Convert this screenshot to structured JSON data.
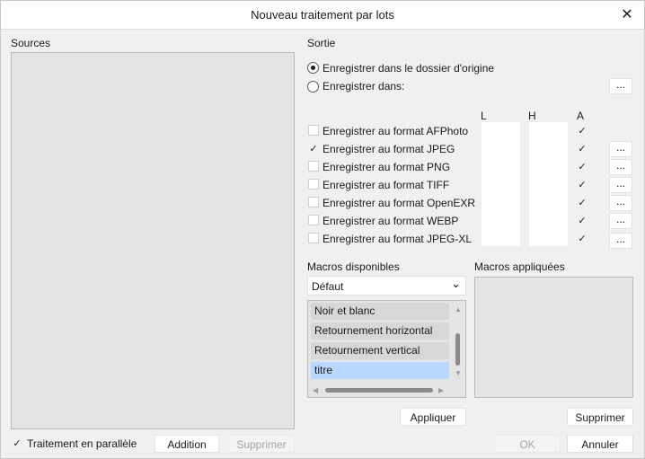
{
  "dialog": {
    "title": "Nouveau traitement par lots"
  },
  "sources": {
    "label": "Sources",
    "parallel_label": "Traitement en parallèle",
    "parallel_checked": true,
    "add_label": "Addition",
    "remove_label": "Supprimer"
  },
  "output": {
    "label": "Sortie",
    "save_origin_label": "Enregistrer dans le dossier d'origine",
    "save_in_label": "Enregistrer dans:",
    "browse_label": "...",
    "col_w": "L",
    "col_h": "H",
    "col_a": "A",
    "formats": [
      {
        "label": "Enregistrer au format AFPhoto",
        "checked": false,
        "a": "✓",
        "options": ""
      },
      {
        "label": "Enregistrer au format JPEG",
        "checked": true,
        "a": "✓",
        "options": "..."
      },
      {
        "label": "Enregistrer au format PNG",
        "checked": false,
        "a": "✓",
        "options": "..."
      },
      {
        "label": "Enregistrer au format TIFF",
        "checked": false,
        "a": "✓",
        "options": "..."
      },
      {
        "label": "Enregistrer au format OpenEXR",
        "checked": false,
        "a": "✓",
        "options": "..."
      },
      {
        "label": "Enregistrer au format WEBP",
        "checked": false,
        "a": "✓",
        "options": "..."
      },
      {
        "label": "Enregistrer au format JPEG-XL",
        "checked": false,
        "a": "✓",
        "options": "..."
      }
    ]
  },
  "macros": {
    "available_label": "Macros disponibles",
    "applied_label": "Macros appliquées",
    "category": "Défaut",
    "items": [
      "Noir et blanc",
      "Retournement horizontal",
      "Retournement vertical",
      "titre"
    ],
    "selected_index": 3,
    "apply_label": "Appliquer",
    "remove_label": "Supprimer"
  },
  "footer": {
    "ok_label": "OK",
    "cancel_label": "Annuler"
  },
  "icons": {
    "close": "✕",
    "check": "✓",
    "chevron_down": "⌄",
    "arrow_up": "▲",
    "arrow_down": "▼",
    "arrow_left": "◀",
    "arrow_right": "▶"
  },
  "colors": {
    "selection": "#b8d8ff",
    "panel": "#e4e4e4",
    "dialog_bg": "#f0f0f0"
  }
}
